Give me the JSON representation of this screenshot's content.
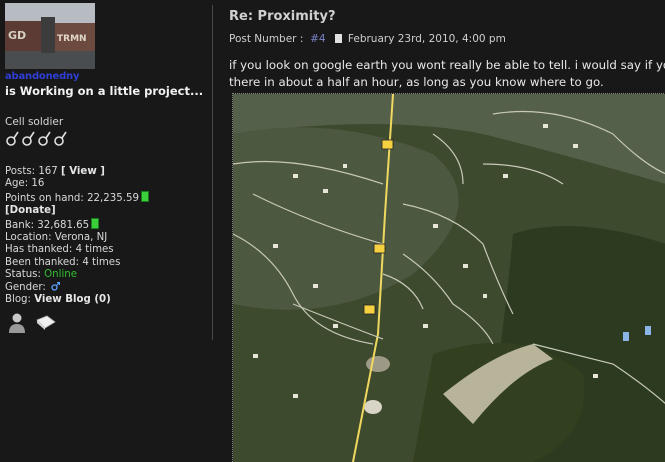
{
  "user": {
    "username": "abandonedny",
    "title": "is Working on a little project...",
    "rank": "Cell soldier"
  },
  "stats": {
    "posts_label": "Posts:",
    "posts": "167",
    "view_link": "[ View ]",
    "age_label": "Age:",
    "age": "16",
    "points_label": "Points on hand:",
    "points": "22,235.59",
    "donate": "[Donate]",
    "bank_label": "Bank:",
    "bank": "32,681.65",
    "location_label": "Location:",
    "location": "Verona, NJ",
    "has_thanked_label": "Has thanked:",
    "has_thanked": "4 times",
    "been_thanked_label": "Been thanked:",
    "been_thanked": "4 times",
    "status_label": "Status:",
    "status": "Online",
    "gender_label": "Gender:",
    "blog_label": "Blog:",
    "blog": "View Blog (0)"
  },
  "post": {
    "title": "Re: Proximity?",
    "number_label": "Post Number :",
    "number": "#4",
    "date": "February 23rd, 2010, 4:00 pm",
    "line1": "if you look on google earth you wont really be able to tell. i would say if you",
    "line2": "there in about a half an hour, as long as you know where to go."
  },
  "colors": {
    "background": "#181818",
    "username": "#2f3fd6",
    "status_online": "#2fbf2f"
  },
  "icons": [
    "user-profile-icon",
    "private-message-icon",
    "document-icon",
    "coin-icon",
    "gender-male-icon"
  ]
}
